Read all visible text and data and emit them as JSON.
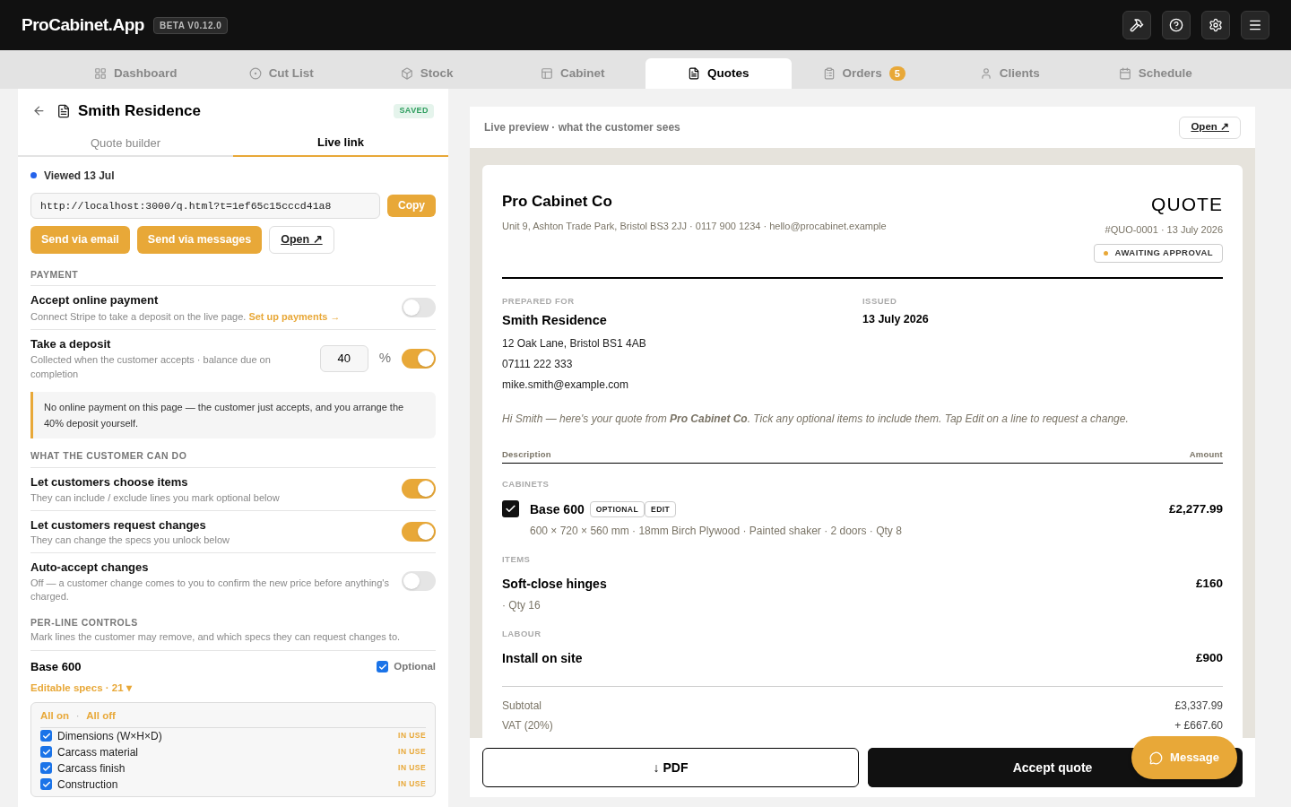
{
  "app": {
    "logo": "ProCabinet.App",
    "version": "BETA V0.12.0",
    "header_buttons": [
      {
        "kind": "hammer"
      },
      {
        "kind": "help"
      },
      {
        "kind": "settings"
      },
      {
        "kind": "menu"
      }
    ]
  },
  "nav_tabs": [
    {
      "label": "Dashboard",
      "selected": false
    },
    {
      "label": "Cut List",
      "selected": false
    },
    {
      "label": "Stock",
      "selected": false
    },
    {
      "label": "Cabinet",
      "selected": false
    },
    {
      "label": "Quotes",
      "selected": true
    },
    {
      "label": "Orders",
      "selected": false,
      "badge": "5"
    },
    {
      "label": "Clients",
      "selected": false
    },
    {
      "label": "Schedule",
      "selected": false
    }
  ],
  "editor": {
    "title": "Smith Residence",
    "status": "SAVED",
    "tabs": [
      {
        "label": "Quote builder",
        "selected": false
      },
      {
        "label": "Live link",
        "selected": true
      }
    ],
    "viewed": "Viewed 13 Jul",
    "link": "http://localhost:3000/q.html?t=1ef65c15cccd41a8",
    "copy": "Copy",
    "send_buttons": [
      "Send via email",
      "Send via messages"
    ],
    "open": "Open ↗",
    "payment_heading": "PAYMENT",
    "payment_rows": [
      {
        "title": "Accept online payment",
        "text": "Connect Stripe to take a deposit on the live page.",
        "link": "Set up payments →",
        "on": false
      },
      {
        "title": "Take a deposit",
        "text": "Collected when the customer accepts · balance due on completion",
        "value": "40",
        "unit": "%",
        "on": true
      }
    ],
    "note": "No online payment on this page — the customer just accepts, and you arrange the 40% deposit yourself.",
    "customer_heading": "WHAT THE CUSTOMER CAN DO",
    "customer_rows": [
      {
        "title": "Let customers choose items",
        "text": "They can include / exclude lines you mark optional below",
        "on": true
      },
      {
        "title": "Let customers request changes",
        "text": "They can change the specs you unlock below",
        "on": true
      },
      {
        "title": "Auto-accept changes",
        "text": "Off — a customer change comes to you to confirm the new price before anything's charged.",
        "on": false
      }
    ],
    "perline_heading": "PER-LINE CONTROLS",
    "perline_text": "Mark lines the customer may remove, and which specs they can request changes to.",
    "line": {
      "name": "Base 600",
      "optional_label": "Optional",
      "optional": true,
      "specs_toggle": "Editable specs · 21 ▾",
      "all_on": "All on",
      "separator": "·",
      "all_off": "All off",
      "specs": [
        {
          "label": "Dimensions (W×H×D)",
          "checked": true,
          "tag": "IN USE"
        },
        {
          "label": "Carcass material",
          "checked": true,
          "tag": "IN USE"
        },
        {
          "label": "Carcass finish",
          "checked": true,
          "tag": "IN USE"
        },
        {
          "label": "Construction",
          "checked": true,
          "tag": "IN USE"
        }
      ]
    }
  },
  "preview": {
    "caption": "Live preview · what the customer sees",
    "open": "Open ↗",
    "company": "Pro Cabinet Co",
    "company_info": "Unit 9, Ashton Trade Park, Bristol BS3 2JJ · 0117 900 1234 · hello@procabinet.example",
    "doc_title": "QUOTE",
    "doc_ref": "#QUO-0001 · 13 July 2026",
    "status": "AWAITING APPROVAL",
    "prepared_label": "PREPARED FOR",
    "client": "Smith Residence",
    "client_lines": [
      "12 Oak Lane, Bristol BS1 4AB",
      "07111 222 333",
      "mike.smith@example.com"
    ],
    "issued_label": "ISSUED",
    "issued": "13 July 2026",
    "intro": "Hi Smith — here's your quote from **Pro Cabinet Co**. Tick any optional items to include them. Tap Edit on a line to request a change.",
    "columns": [
      "Description",
      "Amount"
    ],
    "sections": [
      {
        "heading": "CABINETS",
        "lines": [
          {
            "name": "Base 600",
            "checked": true,
            "tags": [
              "OPTIONAL",
              "EDIT"
            ],
            "detail": "600 × 720 × 560 mm · 18mm Birch Plywood · Painted shaker · 2 doors · Qty 8",
            "amount": "£2,277.99"
          }
        ]
      },
      {
        "heading": "ITEMS",
        "lines": [
          {
            "name": "Soft-close hinges",
            "detail": "· Qty 16",
            "amount": "£160"
          }
        ]
      },
      {
        "heading": "LABOUR",
        "lines": [
          {
            "name": "Install on site",
            "amount": "£900"
          }
        ]
      }
    ],
    "totals": [
      {
        "label": "Subtotal",
        "value": "£3,337.99"
      },
      {
        "label": "VAT (20%)",
        "value": "+ £667.60"
      }
    ],
    "pdf": "↓ PDF",
    "accept": "Accept quote",
    "message": "Message"
  }
}
